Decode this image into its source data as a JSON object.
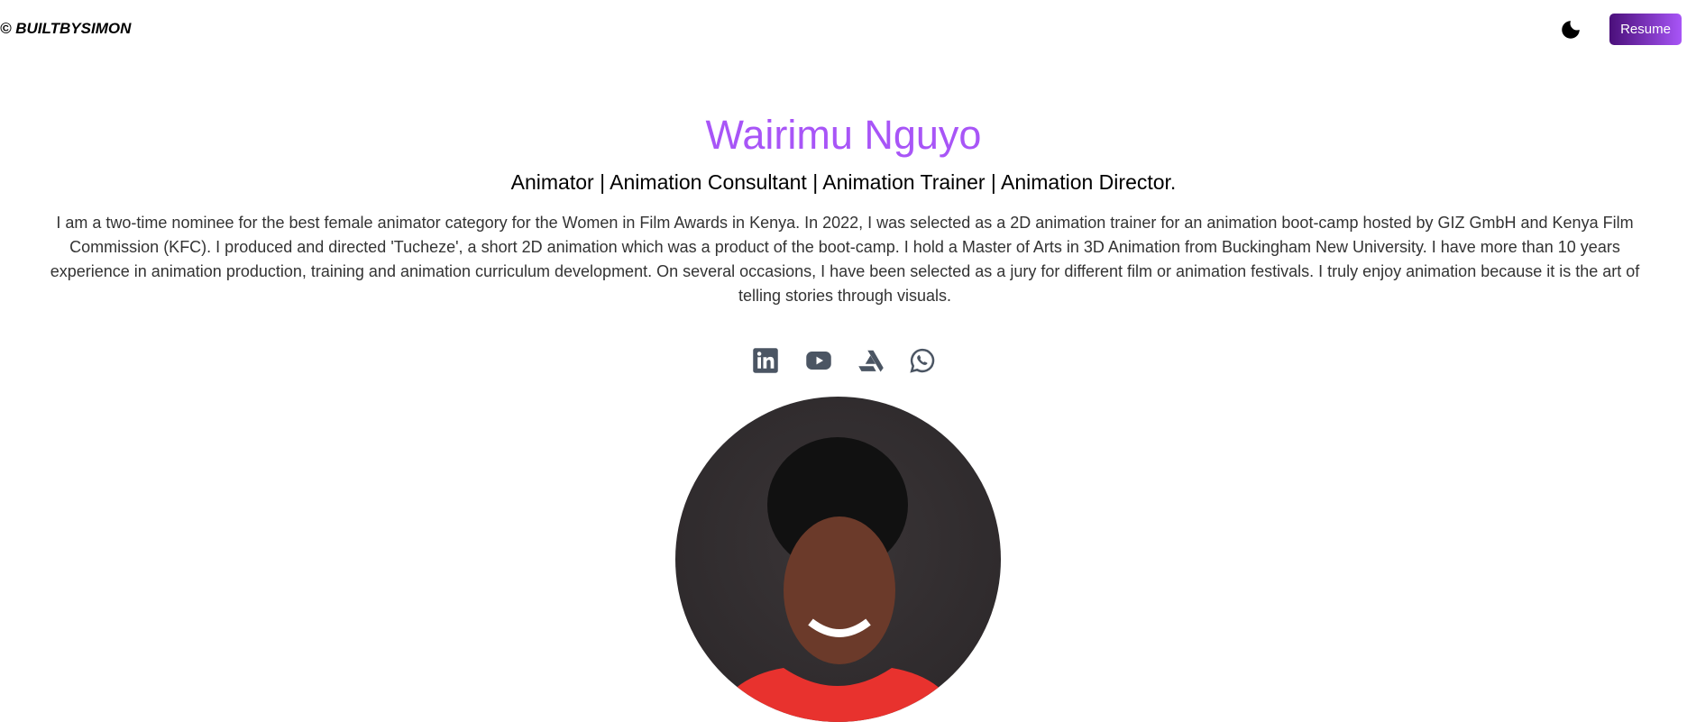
{
  "header": {
    "logo": "© BUILTBYSIMON",
    "theme_toggle_icon": "moon-icon",
    "resume_label": "Resume"
  },
  "hero": {
    "name": "Wairimu Nguyo",
    "subtitle": "Animator | Animation Consultant | Animation Trainer | Animation Director.",
    "bio": "I am a two-time nominee for the best female animator category for the Women in Film Awards in Kenya. In 2022, I was selected as a 2D animation trainer for an animation boot-camp hosted by GIZ GmbH and Kenya Film Commission (KFC). I produced and directed 'Tucheze', a short 2D animation which was a product of the boot-camp. I hold a Master of Arts in 3D Animation from Buckingham New University. I have more than 10 years experience in animation production, training and animation curriculum development. On several occasions, I have been selected as a jury for different film or animation festivals. I truly enjoy animation because it is the art of telling stories through visuals.",
    "socials": [
      "linkedin-icon",
      "youtube-icon",
      "artstation-icon",
      "whatsapp-icon"
    ]
  },
  "colors": {
    "accent": "#a855f7",
    "button_start": "#4a0f7a",
    "icon": "#4b5563"
  }
}
